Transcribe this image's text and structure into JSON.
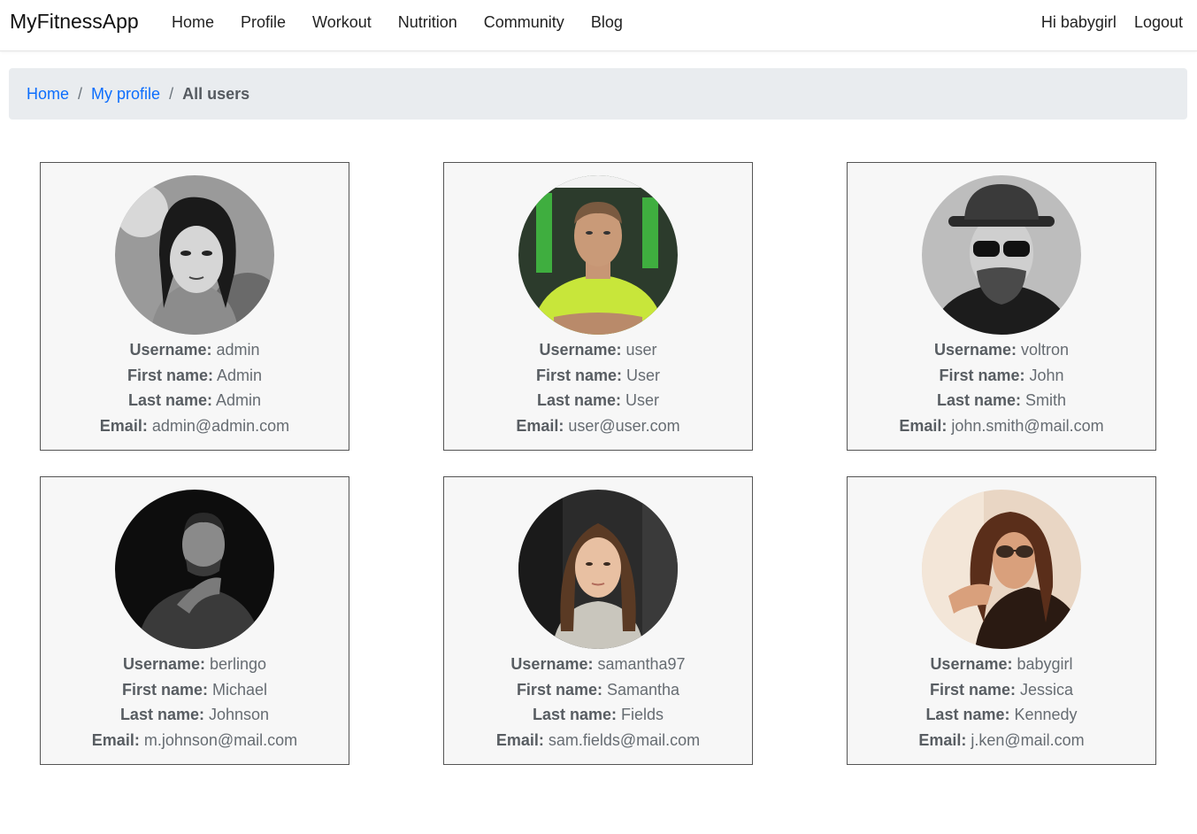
{
  "navbar": {
    "brand": "MyFitnessApp",
    "links": [
      "Home",
      "Profile",
      "Workout",
      "Nutrition",
      "Community",
      "Blog"
    ],
    "greeting": "Hi babygirl",
    "logout": "Logout"
  },
  "breadcrumb": {
    "home": "Home",
    "profile": "My profile",
    "current": "All users",
    "separator": "/"
  },
  "labels": {
    "username": "Username:",
    "first_name": "First name:",
    "last_name": "Last name:",
    "email": "Email:"
  },
  "users": [
    {
      "username": "admin",
      "first_name": "Admin",
      "last_name": "Admin",
      "email": "admin@admin.com"
    },
    {
      "username": "user",
      "first_name": "User",
      "last_name": "User",
      "email": "user@user.com"
    },
    {
      "username": "voltron",
      "first_name": "John",
      "last_name": "Smith",
      "email": "john.smith@mail.com"
    },
    {
      "username": "berlingo",
      "first_name": "Michael",
      "last_name": "Johnson",
      "email": "m.johnson@mail.com"
    },
    {
      "username": "samantha97",
      "first_name": "Samantha",
      "last_name": "Fields",
      "email": "sam.fields@mail.com"
    },
    {
      "username": "babygirl",
      "first_name": "Jessica",
      "last_name": "Kennedy",
      "email": "j.ken@mail.com"
    }
  ],
  "colors": {
    "link": "#0d6efd",
    "breadcrumb_bg": "#e9ecef",
    "card_bg": "#f7f7f7",
    "card_border": "#555555"
  }
}
